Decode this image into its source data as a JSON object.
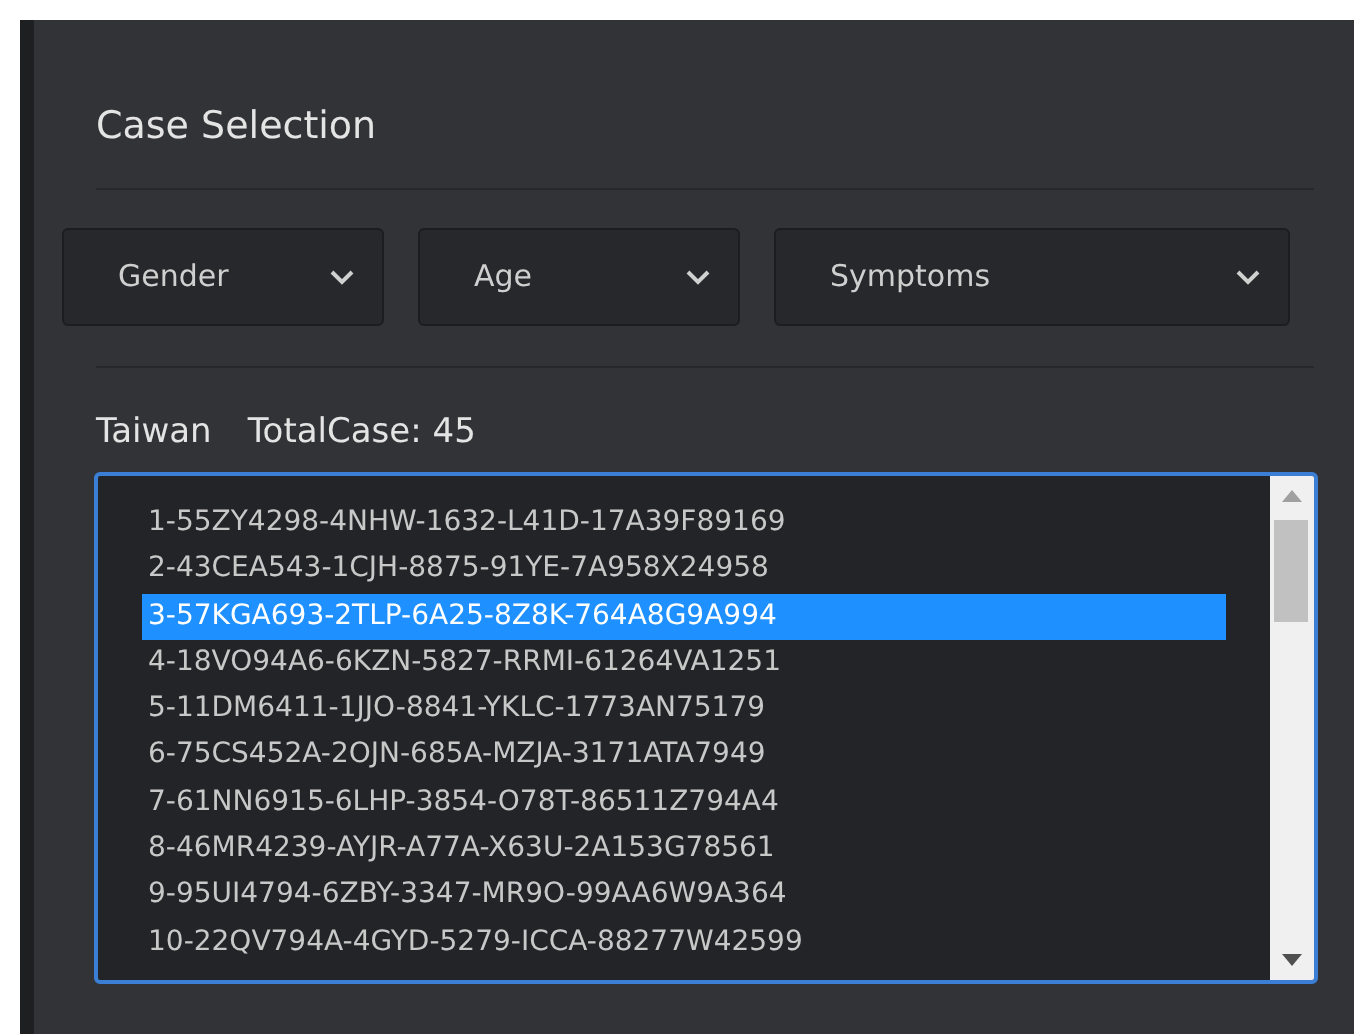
{
  "panel": {
    "title": "Case Selection"
  },
  "filters": [
    {
      "label": "Gender"
    },
    {
      "label": "Age"
    },
    {
      "label": "Symptoms"
    }
  ],
  "summary": {
    "region": "Taiwan",
    "total": "TotalCase: 45"
  },
  "cases": [
    {
      "label": "1-55ZY4298-4NHW-1632-L41D-17A39F89169",
      "selected": false
    },
    {
      "label": "2-43CEA543-1CJH-8875-91YE-7A958X24958",
      "selected": false
    },
    {
      "label": "3-57KGA693-2TLP-6A25-8Z8K-764A8G9A994",
      "selected": true
    },
    {
      "label": "4-18VO94A6-6KZN-5827-RRMI-61264VA1251",
      "selected": false
    },
    {
      "label": "5-11DM6411-1JJO-8841-YKLC-1773AN75179",
      "selected": false
    },
    {
      "label": "6-75CS452A-2OJN-685A-MZJA-3171ATA7949",
      "selected": false
    },
    {
      "label": "7-61NN6915-6LHP-3854-O78T-86511Z794A4",
      "selected": false
    },
    {
      "label": "8-46MR4239-AYJR-A77A-X63U-2A153G78561",
      "selected": false
    },
    {
      "label": "9-95UI4794-6ZBY-3347-MR9O-99AA6W9A364",
      "selected": false
    },
    {
      "label": "10-22QV794A-4GYD-5279-ICCA-88277W42599",
      "selected": false
    }
  ]
}
